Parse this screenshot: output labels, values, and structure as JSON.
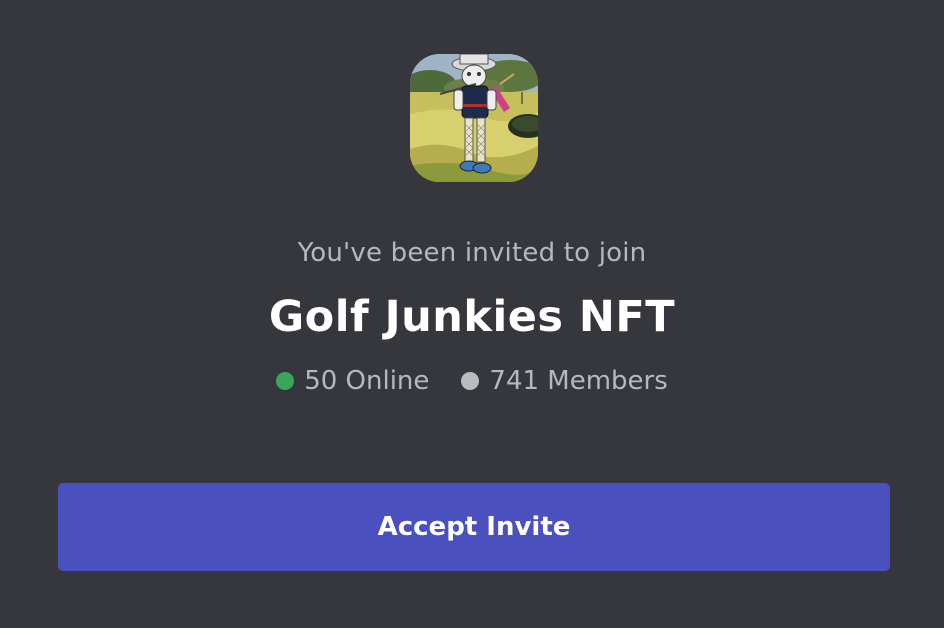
{
  "invite": {
    "server_icon": "golf-character-server-icon",
    "subtitle": "You've been invited to join",
    "server_name": "Golf Junkies NFT",
    "online_count": "50 Online",
    "member_count": "741 Members",
    "accept_label": "Accept Invite"
  },
  "colors": {
    "background": "#36373d",
    "button": "#4a50be",
    "online_dot": "#3ba55d",
    "members_dot": "#b9bbbe",
    "title": "#ffffff",
    "muted_text": "#b5b8be"
  }
}
